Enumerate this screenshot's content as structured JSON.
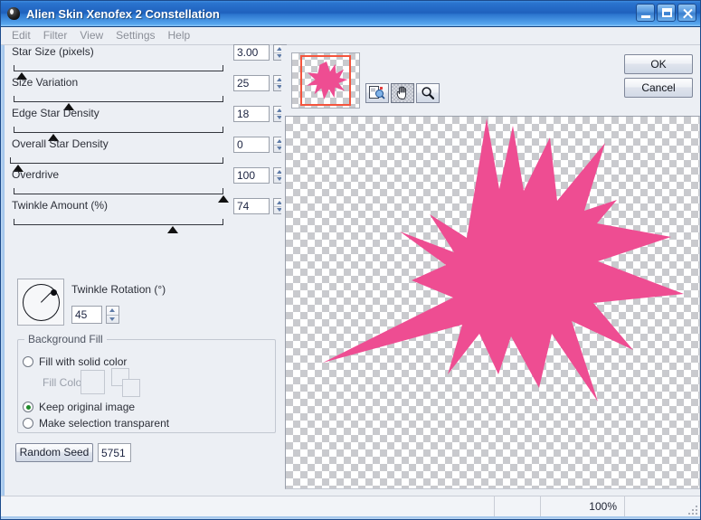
{
  "window": {
    "title": "Alien Skin Xenofex 2 Constellation",
    "icon": "app-blob-icon",
    "buttons": {
      "minimize": "minimize-icon",
      "maximize": "maximize-icon",
      "close": "close-icon"
    }
  },
  "menubar": {
    "items": [
      {
        "label": "Edit"
      },
      {
        "label": "Filter"
      },
      {
        "label": "View"
      },
      {
        "label": "Settings"
      },
      {
        "label": "Help"
      }
    ]
  },
  "sliders": [
    {
      "label": "Star Size (pixels)",
      "value": "3.00",
      "percent": 4
    },
    {
      "label": "Size Variation",
      "value": "25",
      "percent": 25
    },
    {
      "label": "Edge Star Density",
      "value": "18",
      "percent": 18
    },
    {
      "label": "Overall Star Density",
      "value": "0",
      "percent": 0
    },
    {
      "label": "Overdrive",
      "value": "100",
      "percent": 100
    },
    {
      "label": "Twinkle Amount (%)",
      "value": "74",
      "percent": 74
    }
  ],
  "twinkle_rotation": {
    "label": "Twinkle Rotation (°)",
    "value": "45",
    "angle_degrees": 45,
    "dial": "rotation-dial"
  },
  "background_fill": {
    "title": "Background Fill",
    "options": [
      {
        "label": "Fill with solid color",
        "selected": false
      },
      {
        "label": "Keep original image",
        "selected": true
      },
      {
        "label": "Make selection transparent",
        "selected": false
      }
    ],
    "fill_color_label": "Fill Color",
    "fill_color_disabled": true
  },
  "random_seed": {
    "button_label": "Random Seed",
    "value": "5751"
  },
  "preview": {
    "navigator": {
      "name": "thumbnail-navigator",
      "selection_color": "#f4543d"
    },
    "tools": [
      {
        "name": "preview-compare-tool",
        "active": false
      },
      {
        "name": "hand-pan-tool",
        "active": true
      },
      {
        "name": "zoom-magnifier-tool",
        "active": false
      }
    ],
    "star_color": "#ee4d92",
    "checker_color": "#c9cace"
  },
  "dialog_buttons": {
    "ok": "OK",
    "cancel": "Cancel"
  },
  "statusbar": {
    "zoom": "100%",
    "grip": "resize-grip-icon"
  },
  "colors": {
    "titlebar_blue": "#1f61bd",
    "accent_pink": "#ee4d92",
    "panel_bg": "#eceff4",
    "radio_on": "#1f8b2b"
  }
}
